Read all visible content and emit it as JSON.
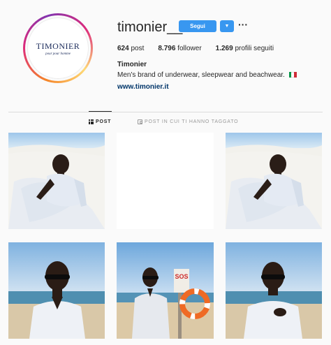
{
  "profile": {
    "avatar_logo_text": "TIMONIER",
    "avatar_logo_subtext": "pour pour homme",
    "username": "timonier__",
    "follow_label": "Segui",
    "dropdown_icon": "chevron-down-icon",
    "more_icon": "ellipsis-icon",
    "more_label": "···"
  },
  "stats": {
    "posts_count": "624",
    "posts_label": "post",
    "followers_count": "8.796",
    "followers_label": "follower",
    "following_count": "1.269",
    "following_label": "profili seguiti"
  },
  "bio": {
    "full_name": "Timonier",
    "text": "Men's brand of underwear, sleepwear and beachwear.",
    "flag_icon": "italy-flag-icon",
    "flag_colors": [
      "#009246",
      "#ffffff",
      "#ce2b37"
    ],
    "website": "www.timonier.it"
  },
  "tabs": [
    {
      "label": "POST",
      "icon": "grid-icon",
      "active": true
    },
    {
      "label": "POST IN CUI TI HANNO TAGGATO",
      "icon": "tag-icon",
      "active": false
    }
  ],
  "colors": {
    "accent": "#3897f0",
    "text": "#262626",
    "link": "#003569",
    "muted": "#999999"
  },
  "posts": [
    {
      "subject": "man in white shirt reclining on sand dune"
    },
    {
      "subject": "blank white post"
    },
    {
      "subject": "man in white shirt reclining on sand dune"
    },
    {
      "subject": "man in sunglasses at the beach"
    },
    {
      "subject": "man in white shirt next to SOS lifebuoy sign",
      "sign_text": "SOS"
    },
    {
      "subject": "man in sunglasses adjusting shirt at the beach"
    }
  ]
}
